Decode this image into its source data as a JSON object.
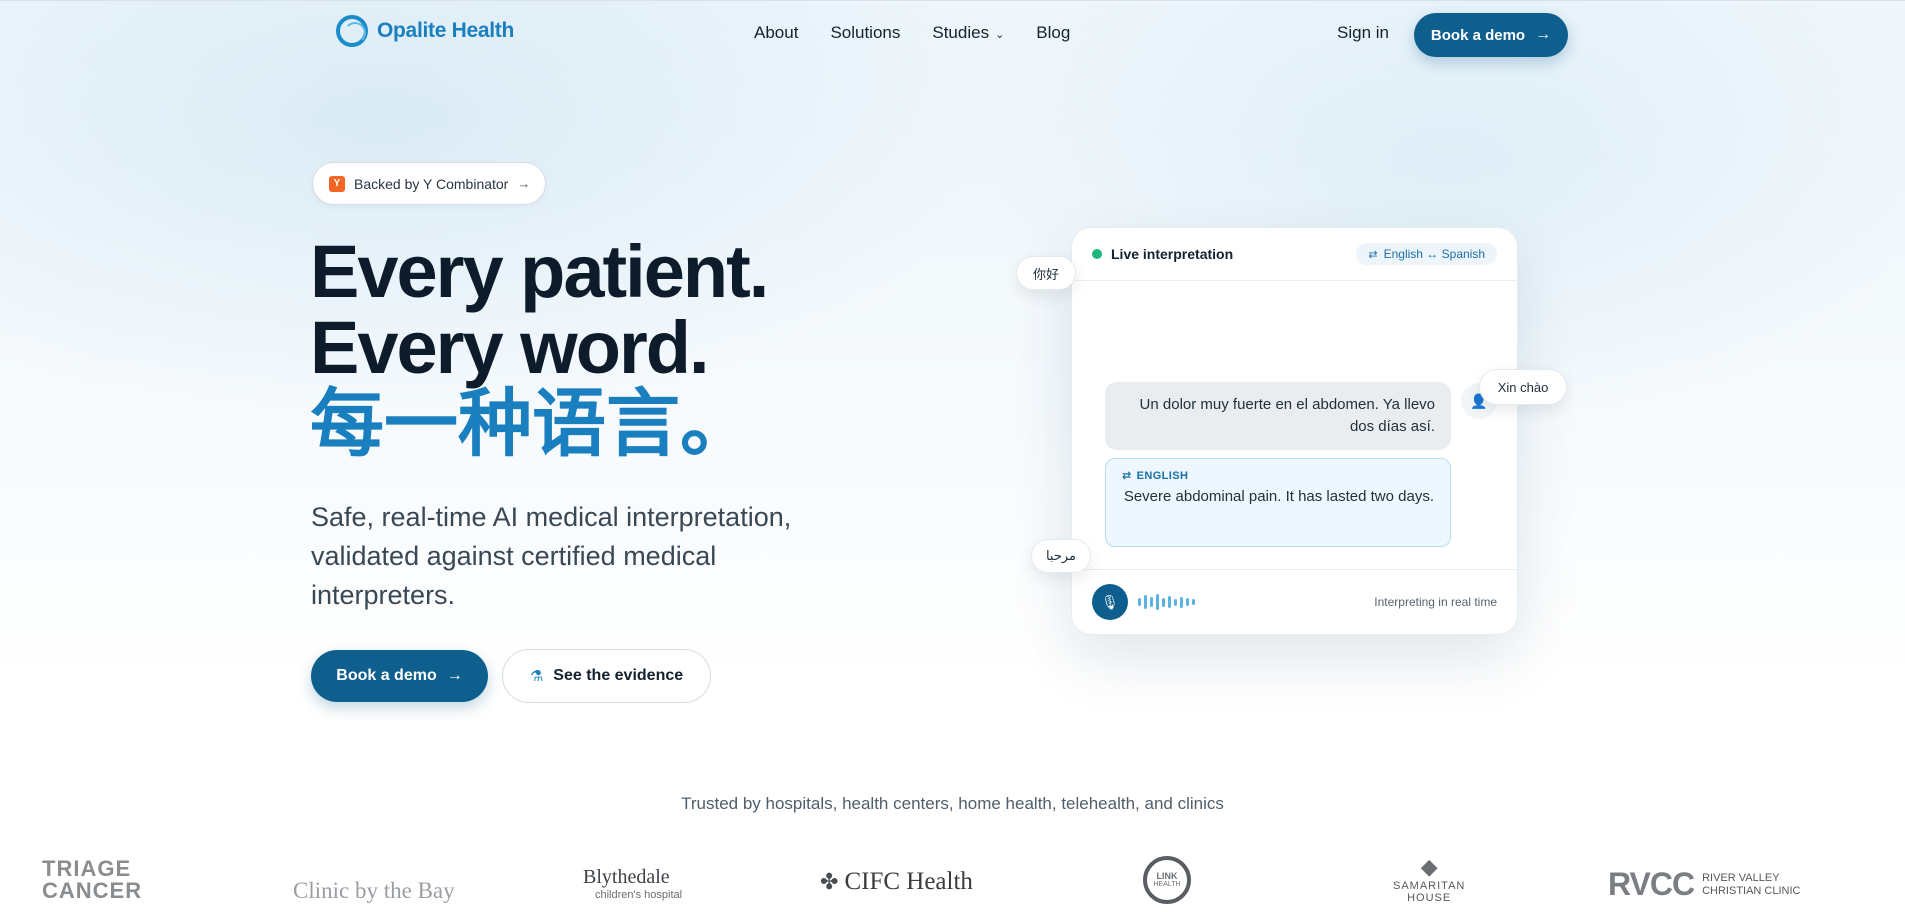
{
  "nav": {
    "brand": "Opalite Health",
    "links": [
      {
        "label": "About"
      },
      {
        "label": "Solutions"
      },
      {
        "label": "Studies"
      },
      {
        "label": "Blog"
      }
    ],
    "sign_in": "Sign in",
    "demo_label": "Book a demo",
    "arrow": "→"
  },
  "hero": {
    "badge_logo": "Y",
    "badge_text": "Backed by Y Combinator",
    "badge_arrow": "→",
    "headline_1": "Every patient.",
    "headline_2": "Every word.",
    "headline_3": "每一种语言。",
    "subtitle": "Safe, real-time AI medical interpretation, validated against certified medical interpreters.",
    "primary_cta": "Book a demo",
    "secondary_cta": "See the evidence"
  },
  "card": {
    "live_label": "Live interpretation",
    "lang_pair": "English ↔ Spanish",
    "spanish_msg": "Un dolor muy fuerte en el abdomen. Ya llevo dos días así.",
    "english_label": "ENGLISH",
    "english_msg": "Severe abdominal pain. It has lasted two days.",
    "status": "Interpreting in real time",
    "floating": {
      "chinese": "你好",
      "vietnamese": "Xin chào",
      "arabic": "مرحبا"
    }
  },
  "trusted": {
    "caption": "Trusted by hospitals, health centers, home health, telehealth, and clinics",
    "logos": [
      "TRIAGE CANCER",
      "Clinic by the Bay",
      "Blythedale",
      "children's hospital",
      "CIFC Health",
      "LINK",
      "HEALTH",
      "SAMARITAN",
      "HOUSE",
      "RVCC",
      "RIVER VALLEY",
      "CHRISTIAN CLINIC"
    ]
  },
  "colors": {
    "brand": "#1a7fbf",
    "primary_button": "#0f5f8e",
    "live_dot": "#1fb77a"
  }
}
